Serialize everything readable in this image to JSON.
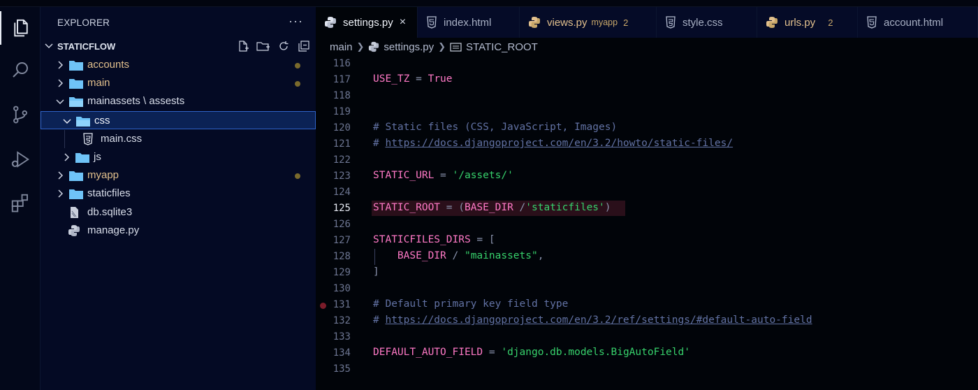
{
  "explorer": {
    "title": "EXPLORER",
    "more": "···",
    "project": "STATICFLOW",
    "tree": [
      {
        "label": "accounts",
        "kind": "folder",
        "modified": true
      },
      {
        "label": "main",
        "kind": "folder",
        "modified": true
      },
      {
        "label": "mainassets \\ assests",
        "kind": "folder-open"
      },
      {
        "label": "css",
        "kind": "folder-open",
        "selected": true
      },
      {
        "label": "main.css",
        "kind": "css-file"
      },
      {
        "label": "js",
        "kind": "folder"
      },
      {
        "label": "myapp",
        "kind": "folder",
        "modified": true
      },
      {
        "label": "staticfiles",
        "kind": "folder"
      },
      {
        "label": "db.sqlite3",
        "kind": "db-file"
      },
      {
        "label": "manage.py",
        "kind": "python-file"
      }
    ]
  },
  "tabs": [
    {
      "label": "settings.py",
      "icon": "python-icon",
      "active": true,
      "close": "×"
    },
    {
      "label": "index.html",
      "icon": "html-icon"
    },
    {
      "label": "views.py",
      "icon": "python-icon",
      "sub": "myapp",
      "count": "2",
      "modified": true
    },
    {
      "label": "style.css",
      "icon": "css-icon"
    },
    {
      "label": "urls.py",
      "icon": "python-icon",
      "count": "2",
      "modified": true
    },
    {
      "label": "account.html",
      "icon": "html-icon"
    }
  ],
  "breadcrumb": {
    "folder": "main",
    "file": "settings.py",
    "symbol": "STATIC_ROOT"
  },
  "editor": {
    "current_line": "125",
    "breakpoint_line": "131",
    "lines": [
      {
        "n": "116",
        "tokens": []
      },
      {
        "n": "117",
        "tokens": [
          {
            "t": "USE_TZ",
            "c": "k"
          },
          {
            "t": " = ",
            "c": "o"
          },
          {
            "t": "True",
            "c": "t"
          }
        ]
      },
      {
        "n": "118",
        "tokens": []
      },
      {
        "n": "119",
        "tokens": []
      },
      {
        "n": "120",
        "tokens": [
          {
            "t": "# Static files (CSS, JavaScript, Images)",
            "c": "c"
          }
        ]
      },
      {
        "n": "121",
        "tokens": [
          {
            "t": "# ",
            "c": "c"
          },
          {
            "t": "https://docs.djangoproject.com/en/3.2/howto/static-files/",
            "c": "u"
          }
        ]
      },
      {
        "n": "122",
        "tokens": []
      },
      {
        "n": "123",
        "tokens": [
          {
            "t": "STATIC_URL",
            "c": "k"
          },
          {
            "t": " = ",
            "c": "o"
          },
          {
            "t": "'/assets/'",
            "c": "s"
          }
        ]
      },
      {
        "n": "124",
        "tokens": []
      },
      {
        "n": "125",
        "tokens": [
          {
            "t": "STATIC_ROOT",
            "c": "k"
          },
          {
            "t": " = ",
            "c": "o"
          },
          {
            "t": "(",
            "c": "p"
          },
          {
            "t": "BASE_DIR",
            "c": "k"
          },
          {
            "t": " /",
            "c": "o"
          },
          {
            "t": "'staticfiles'",
            "c": "s"
          },
          {
            "t": ")",
            "c": "p"
          }
        ]
      },
      {
        "n": "126",
        "tokens": []
      },
      {
        "n": "127",
        "tokens": [
          {
            "t": "STATICFILES_DIRS",
            "c": "k"
          },
          {
            "t": " = [",
            "c": "o"
          }
        ]
      },
      {
        "n": "128",
        "tokens": [
          {
            "t": "    ",
            "c": "o"
          },
          {
            "t": "BASE_DIR",
            "c": "k"
          },
          {
            "t": " / ",
            "c": "o"
          },
          {
            "t": "\"mainassets\"",
            "c": "s"
          },
          {
            "t": ",",
            "c": "o"
          }
        ]
      },
      {
        "n": "129",
        "tokens": [
          {
            "t": "]",
            "c": "o"
          }
        ]
      },
      {
        "n": "130",
        "tokens": []
      },
      {
        "n": "131",
        "tokens": [
          {
            "t": "# Default primary key field type",
            "c": "c"
          }
        ]
      },
      {
        "n": "132",
        "tokens": [
          {
            "t": "# ",
            "c": "c"
          },
          {
            "t": "https://docs.djangoproject.com/en/3.2/ref/settings/#default-auto-field",
            "c": "u"
          }
        ]
      },
      {
        "n": "133",
        "tokens": []
      },
      {
        "n": "134",
        "tokens": [
          {
            "t": "DEFAULT_AUTO_FIELD",
            "c": "k"
          },
          {
            "t": " = ",
            "c": "o"
          },
          {
            "t": "'django.db.models.BigAutoField'",
            "c": "s"
          }
        ]
      },
      {
        "n": "135",
        "tokens": []
      }
    ]
  },
  "colors": {
    "keyword": "#ff79c6",
    "string": "#37d26c",
    "comment": "#6272a4",
    "folder": "#6fc3f7",
    "modified": "#e2c08d",
    "selection": "#0b2255"
  }
}
